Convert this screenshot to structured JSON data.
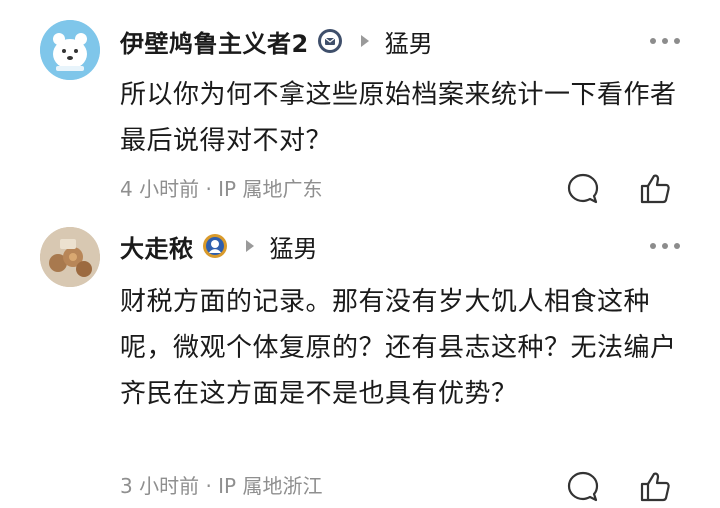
{
  "comments": [
    {
      "username": "伊壁鸠鲁主义者2",
      "reply_to": "猛男",
      "text": "所以你为何不拿这些原始档案来统计一下看作者最后说得对不对？",
      "meta": "4 小时前 · IP 属地广东",
      "avatar_icon": "cartoon-animal-avatar",
      "badge_icon": "verified-badge-icon"
    },
    {
      "username": "大走秾",
      "reply_to": "猛男",
      "text": "财税方面的记录。那有没有岁大饥人相食这种呢，微观个体复原的？还有县志这种？无法编户齐民在这方面是不是也具有优势？",
      "meta": "3 小时前 · IP 属地浙江",
      "avatar_icon": "photo-avatar",
      "badge_icon": "gold-badge-icon"
    }
  ],
  "colors": {
    "text": "#1a1a1a",
    "meta": "#8f8f8f",
    "icon": "#333333"
  }
}
